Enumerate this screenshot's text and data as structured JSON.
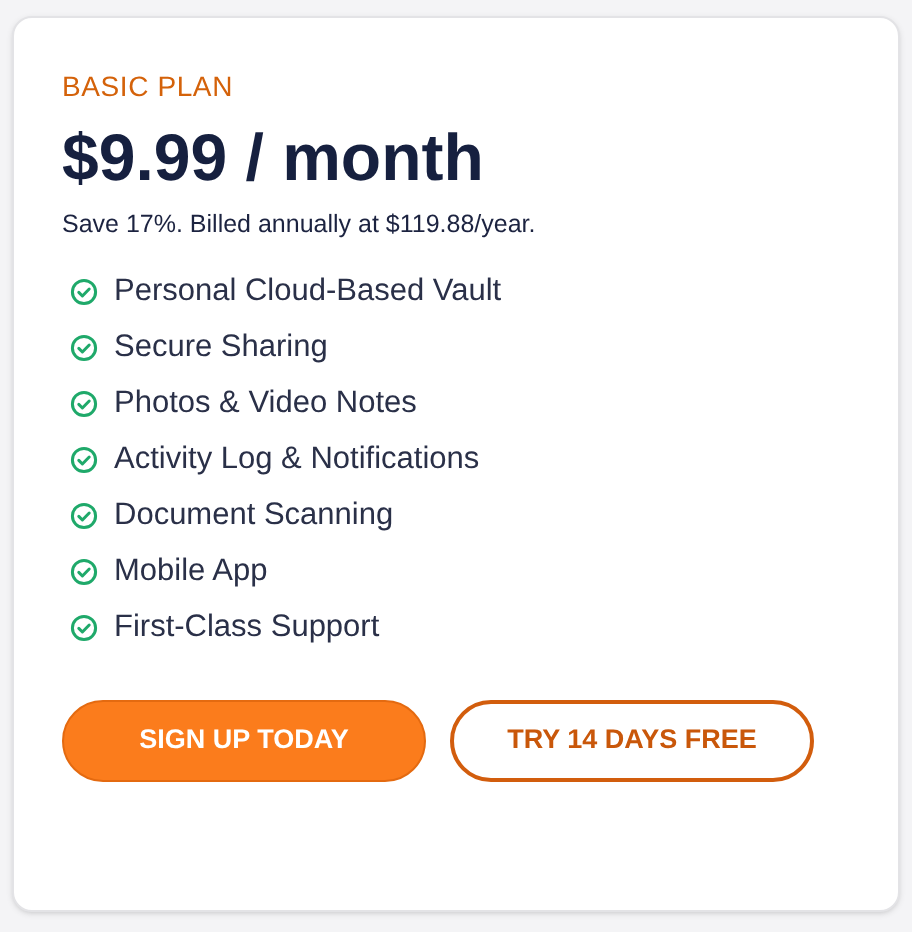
{
  "plan": {
    "name": "BASIC PLAN",
    "price": "$9.99 / month",
    "note": "Save 17%. Billed annually at $119.88/year."
  },
  "features": [
    "Personal Cloud-Based Vault",
    "Secure Sharing",
    "Photos & Video Notes",
    "Activity Log & Notifications",
    "Document Scanning",
    "Mobile App",
    "First-Class Support"
  ],
  "buttons": [
    {
      "label": "SIGN UP TODAY",
      "kind": "primary"
    },
    {
      "label": "TRY 14 DAYS FREE",
      "kind": "outline"
    }
  ]
}
